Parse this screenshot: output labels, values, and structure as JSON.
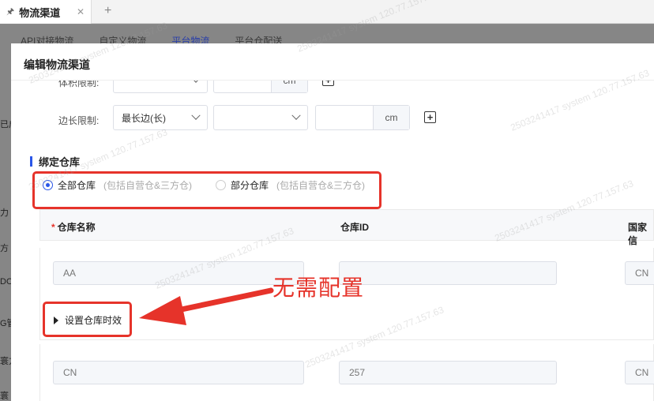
{
  "tabbar": {
    "tab_label": "物流渠道",
    "pin_icon": "pin-icon",
    "add_label": "+"
  },
  "subtabs": [
    "API对接物流",
    "自定义物流",
    "平台物流",
    "平台仓配送"
  ],
  "left_fragments": [
    "已启",
    "力",
    "方",
    "DOT",
    "G管",
    "寰方",
    "寰"
  ],
  "dialog": {
    "title": "编辑物流渠道",
    "row1": {
      "label": "体积限制:",
      "unit": "cm"
    },
    "row2": {
      "label": "边长限制:",
      "select_value": "最长边(长)",
      "unit": "cm"
    },
    "section_title": "绑定仓库",
    "radios": [
      {
        "label": "全部仓库",
        "hint": "(包括自营仓&三方仓)",
        "selected": true
      },
      {
        "label": "部分仓库",
        "hint": "(包括自营仓&三方仓)",
        "selected": false
      }
    ],
    "table": {
      "columns": [
        "仓库名称",
        "仓库ID",
        "国家信"
      ],
      "rows": [
        {
          "name": "AA",
          "id": "",
          "country": "CN"
        },
        {
          "name": "CN",
          "id": "257",
          "country": "CN"
        }
      ],
      "expander_label": "设置仓库时效"
    },
    "annotation": "无需配置"
  },
  "watermark_text": "2503241417 system 120.77.157.63",
  "colors": {
    "primary": "#2a56e8",
    "annotation_red": "#e6332a"
  }
}
